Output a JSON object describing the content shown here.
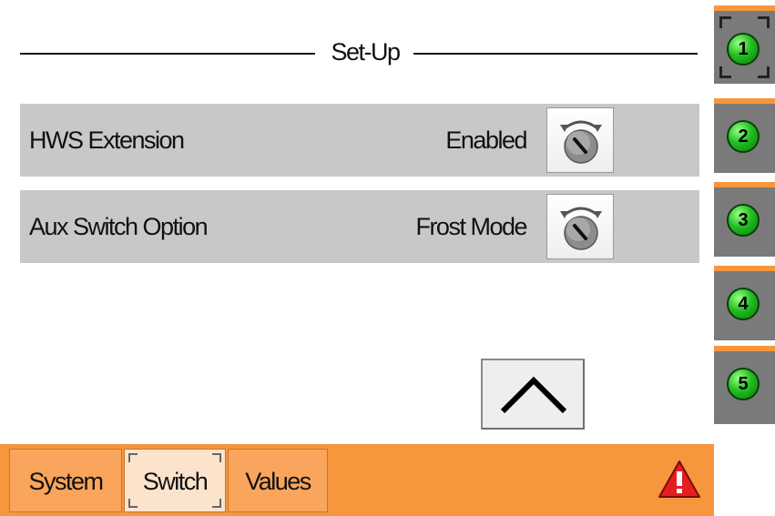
{
  "screen": {
    "title": "Set-Up"
  },
  "settings": [
    {
      "label": "HWS Extension",
      "value": "Enabled",
      "control_icon": "dial-knob-icon"
    },
    {
      "label": "Aux Switch Option",
      "value": "Frost Mode",
      "control_icon": "dial-knob-icon"
    }
  ],
  "navigation": {
    "scroll_up_icon": "chevron-up-icon"
  },
  "side_buttons": [
    {
      "label": "1",
      "selected": true
    },
    {
      "label": "2",
      "selected": false
    },
    {
      "label": "3",
      "selected": false
    },
    {
      "label": "4",
      "selected": false
    },
    {
      "label": "5",
      "selected": false
    }
  ],
  "tabs": [
    {
      "label": "System",
      "selected": false
    },
    {
      "label": "Switch",
      "selected": true
    },
    {
      "label": "Values",
      "selected": false
    }
  ],
  "alert": {
    "icon": "warning-triangle-icon",
    "color": "#e41e1e"
  },
  "colors": {
    "accent": "#f7963c",
    "row_bg": "#c8c8c8",
    "side_button_bg": "#7a7a7a",
    "indicator_green": "#22c022"
  }
}
